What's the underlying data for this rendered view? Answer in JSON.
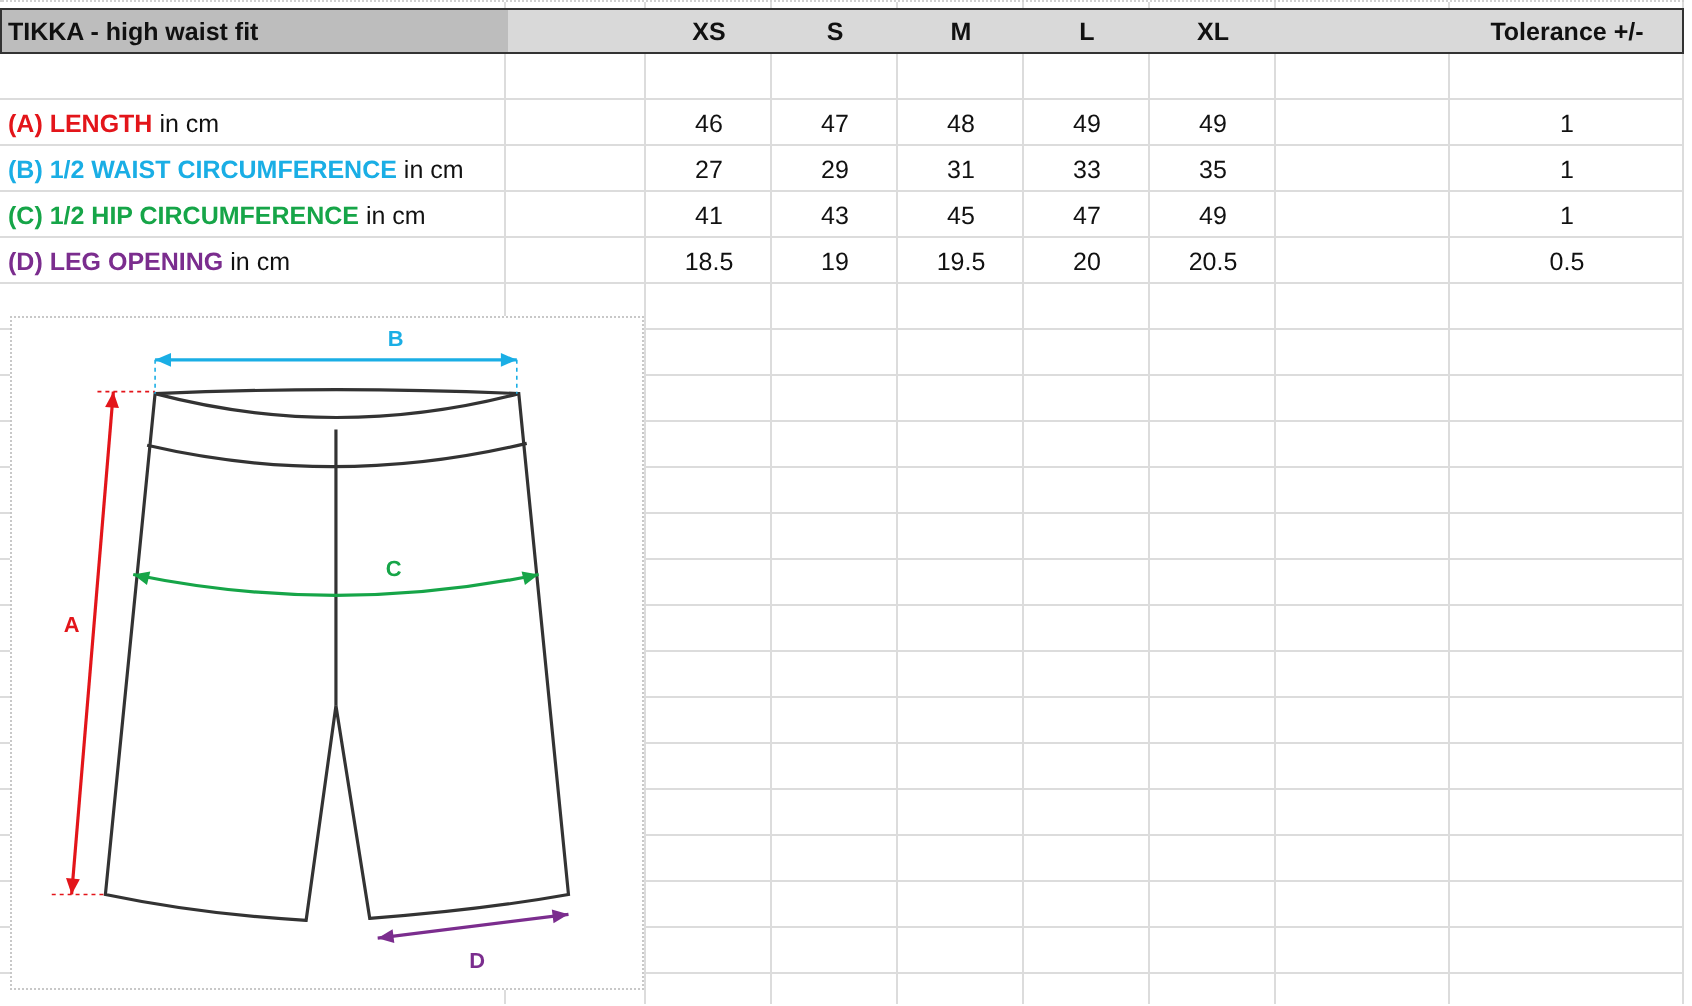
{
  "sheet": {
    "title": "TIKKA - high waist fit",
    "sizes": [
      "XS",
      "S",
      "M",
      "L",
      "XL"
    ],
    "tolerance_header": "Tolerance +/-",
    "rows": [
      {
        "label": "(A) LENGTH",
        "unit": "in cm",
        "color": "#e3151a",
        "values": [
          "46",
          "47",
          "48",
          "49",
          "49"
        ],
        "tolerance": "1"
      },
      {
        "label": "(B) 1/2 WAIST CIRCUMFERENCE",
        "unit": "in cm",
        "color": "#1aaee5",
        "values": [
          "27",
          "29",
          "31",
          "33",
          "35"
        ],
        "tolerance": "1"
      },
      {
        "label": "(C) 1/2 HIP CIRCUMFERENCE",
        "unit": "in cm",
        "color": "#16a548",
        "values": [
          "41",
          "43",
          "45",
          "47",
          "49"
        ],
        "tolerance": "1"
      },
      {
        "label": "(D) LEG OPENING",
        "unit": "in cm",
        "color": "#7b2d8e",
        "values": [
          "18.5",
          "19",
          "19.5",
          "20",
          "20.5"
        ],
        "tolerance": "0.5"
      }
    ]
  },
  "diagram": {
    "markers": [
      {
        "letter": "A"
      },
      {
        "letter": "B"
      },
      {
        "letter": "C"
      },
      {
        "letter": "D"
      }
    ]
  }
}
